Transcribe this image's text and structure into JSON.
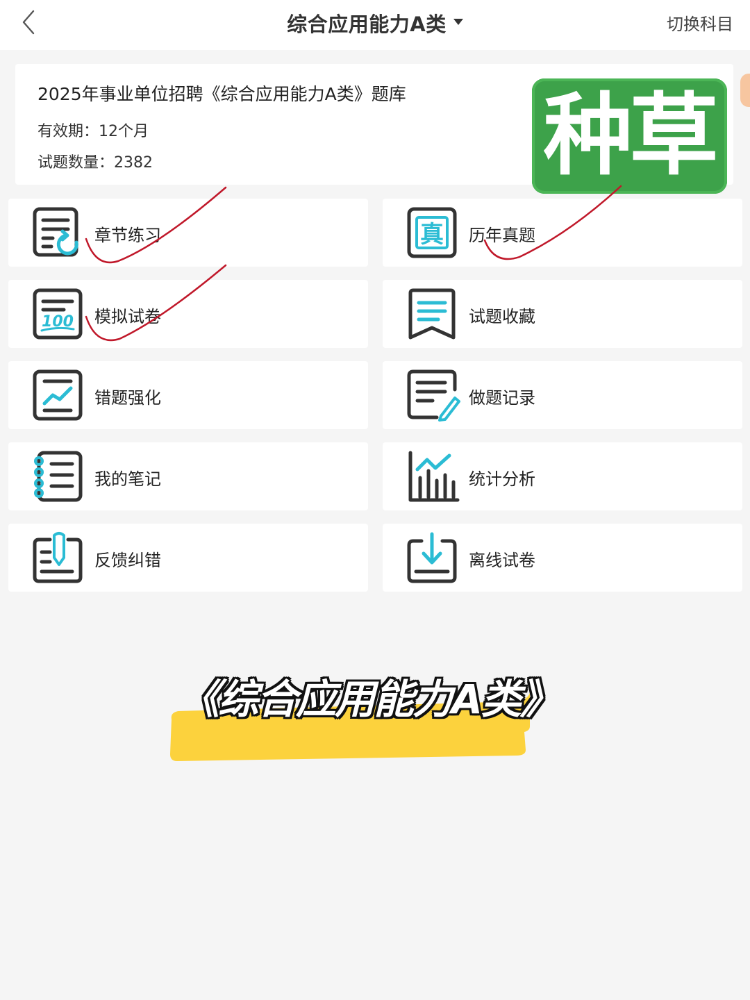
{
  "header": {
    "title": "综合应用能力A类",
    "switch_label": "切换科目"
  },
  "info": {
    "title": "2025年事业单位招聘《综合应用能力A类》题库",
    "validity": "有效期：12个月",
    "question_count": "试题数量：2382"
  },
  "sticker": {
    "text": "种草"
  },
  "menu": {
    "items": [
      {
        "label": "章节练习",
        "icon": "chapter-practice-icon"
      },
      {
        "label": "历年真题",
        "icon": "past-exams-icon"
      },
      {
        "label": "模拟试卷",
        "icon": "mock-exam-icon"
      },
      {
        "label": "试题收藏",
        "icon": "bookmark-icon"
      },
      {
        "label": "错题强化",
        "icon": "wrong-questions-icon"
      },
      {
        "label": "做题记录",
        "icon": "practice-record-icon"
      },
      {
        "label": "我的笔记",
        "icon": "notes-icon"
      },
      {
        "label": "统计分析",
        "icon": "statistics-icon"
      },
      {
        "label": "反馈纠错",
        "icon": "feedback-icon"
      },
      {
        "label": "离线试卷",
        "icon": "offline-download-icon"
      }
    ]
  },
  "caption": {
    "text": "《综合应用能力A类》"
  },
  "colors": {
    "icon_dark": "#333333",
    "icon_accent": "#2bbcd4",
    "sticker_green": "#3da24a",
    "highlight_yellow": "#fcd23d",
    "ink_red": "#c0182a"
  }
}
